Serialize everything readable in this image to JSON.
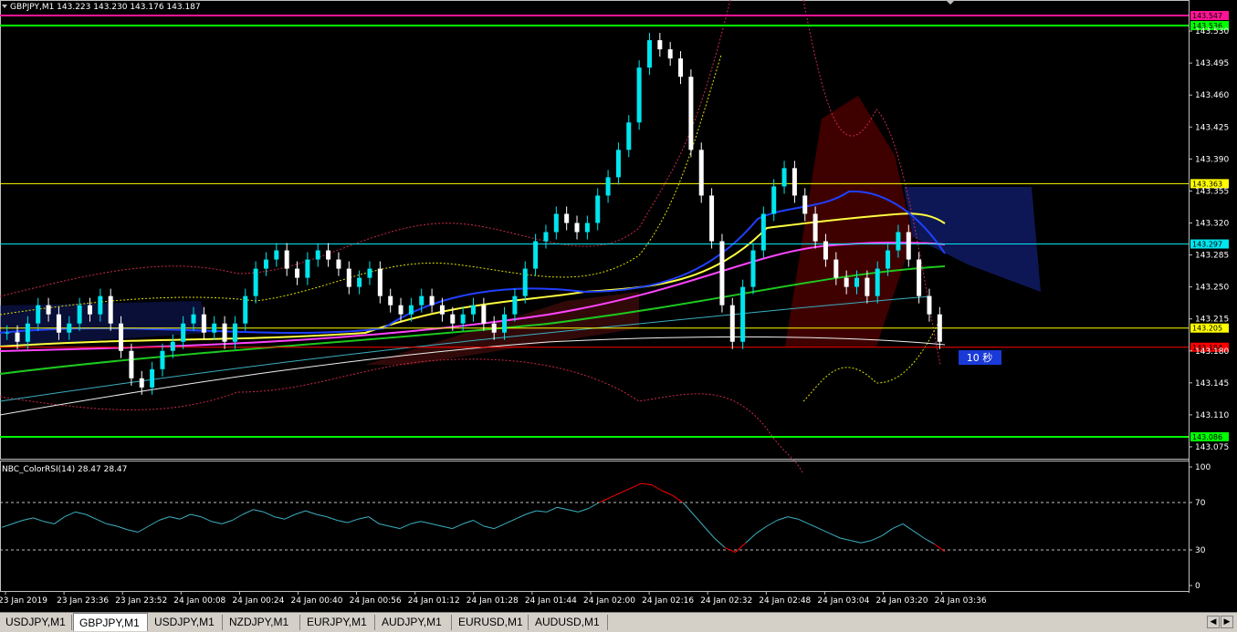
{
  "header": {
    "symbol_info": "GBPJPY,M1  143.223 143.230 143.176 143.187"
  },
  "chart": {
    "price_min": 143.065,
    "price_max": 143.56,
    "price_ticks": [
      "143.530",
      "143.495",
      "143.460",
      "143.425",
      "143.390",
      "143.355",
      "143.320",
      "143.285",
      "143.250",
      "143.215",
      "143.180",
      "143.145",
      "143.110",
      "143.075"
    ],
    "price_tick_values": [
      143.53,
      143.495,
      143.46,
      143.425,
      143.39,
      143.355,
      143.32,
      143.285,
      143.25,
      143.215,
      143.18,
      143.145,
      143.11,
      143.075
    ],
    "levels": [
      {
        "label": "143.547",
        "value": 143.547,
        "color": "#ff1493",
        "label_text_color": "#000"
      },
      {
        "label": "143.536",
        "value": 143.536,
        "color": "#00ff00",
        "label_text_color": "#000"
      },
      {
        "label": "143.363",
        "value": 143.363,
        "color": "#ffff00",
        "label_text_color": "#000"
      },
      {
        "label": "143.297",
        "value": 143.297,
        "color": "#00e5ee",
        "label_text_color": "#000"
      },
      {
        "label": "143.205",
        "value": 143.205,
        "color": "#ffff00",
        "label_text_color": "#000"
      },
      {
        "label": "143.184",
        "value": 143.184,
        "color": "#ff0000",
        "label_text_color": "#000"
      },
      {
        "label": "143.086",
        "value": 143.086,
        "color": "#00ff00",
        "label_text_color": "#000"
      }
    ],
    "timer_label": "10 秒",
    "time_labels": [
      "23 Jan 2019",
      "23 Jan 23:36",
      "23 Jan 23:52",
      "24 Jan 00:08",
      "24 Jan 00:24",
      "24 Jan 00:40",
      "24 Jan 00:56",
      "24 Jan 01:12",
      "24 Jan 01:28",
      "24 Jan 01:44",
      "24 Jan 02:00",
      "24 Jan 02:16",
      "24 Jan 02:32",
      "24 Jan 02:48",
      "24 Jan 03:04",
      "24 Jan 03:20",
      "24 Jan 03:36"
    ]
  },
  "indicator": {
    "title": "NBC_ColorRSI(14) 28.47 28.47",
    "ticks": [
      "100",
      "70",
      "30",
      "0"
    ],
    "tick_values": [
      100,
      70,
      30,
      0
    ],
    "overbought": 70,
    "oversold": 30
  },
  "chart_data": {
    "type": "line",
    "title": "GBPJPY,M1",
    "series": [
      {
        "name": "GBPJPY,M1",
        "values": [
          143.2,
          143.19,
          143.21,
          143.23,
          143.22,
          143.2,
          143.21,
          143.23,
          143.22,
          143.24,
          143.21,
          143.18,
          143.15,
          143.14,
          143.16,
          143.18,
          143.19,
          143.21,
          143.22,
          143.2,
          143.21,
          143.19,
          143.21,
          143.24,
          143.27,
          143.28,
          143.29,
          143.27,
          143.26,
          143.28,
          143.29,
          143.28,
          143.27,
          143.25,
          143.26,
          143.27,
          143.24,
          143.23,
          143.22,
          143.23,
          143.24,
          143.23,
          143.22,
          143.21,
          143.22,
          143.23,
          143.21,
          143.2,
          143.22,
          143.24,
          143.27,
          143.3,
          143.31,
          143.33,
          143.32,
          143.31,
          143.32,
          143.35,
          143.37,
          143.4,
          143.43,
          143.49,
          143.52,
          143.51,
          143.5,
          143.48,
          143.4,
          143.35,
          143.3,
          143.23,
          143.19,
          143.25,
          143.29,
          143.33,
          143.36,
          143.38,
          143.35,
          143.33,
          143.3,
          143.28,
          143.26,
          143.25,
          143.26,
          143.24,
          143.27,
          143.29,
          143.31,
          143.28,
          143.24,
          143.22,
          143.19
        ]
      }
    ],
    "rsi_values": [
      49,
      52,
      55,
      57,
      54,
      52,
      58,
      62,
      60,
      56,
      52,
      50,
      47,
      45,
      50,
      55,
      58,
      56,
      60,
      58,
      54,
      52,
      55,
      60,
      64,
      62,
      58,
      56,
      60,
      63,
      60,
      58,
      55,
      53,
      56,
      58,
      52,
      50,
      48,
      52,
      54,
      52,
      50,
      48,
      52,
      55,
      50,
      48,
      52,
      56,
      60,
      63,
      62,
      66,
      64,
      62,
      65,
      70,
      74,
      78,
      82,
      86,
      85,
      80,
      76,
      70,
      60,
      50,
      40,
      32,
      28,
      36,
      44,
      50,
      55,
      58,
      56,
      52,
      48,
      44,
      40,
      38,
      36,
      38,
      42,
      48,
      52,
      46,
      40,
      35,
      28.47
    ],
    "ylabel": "",
    "xlabel": ""
  }
}
